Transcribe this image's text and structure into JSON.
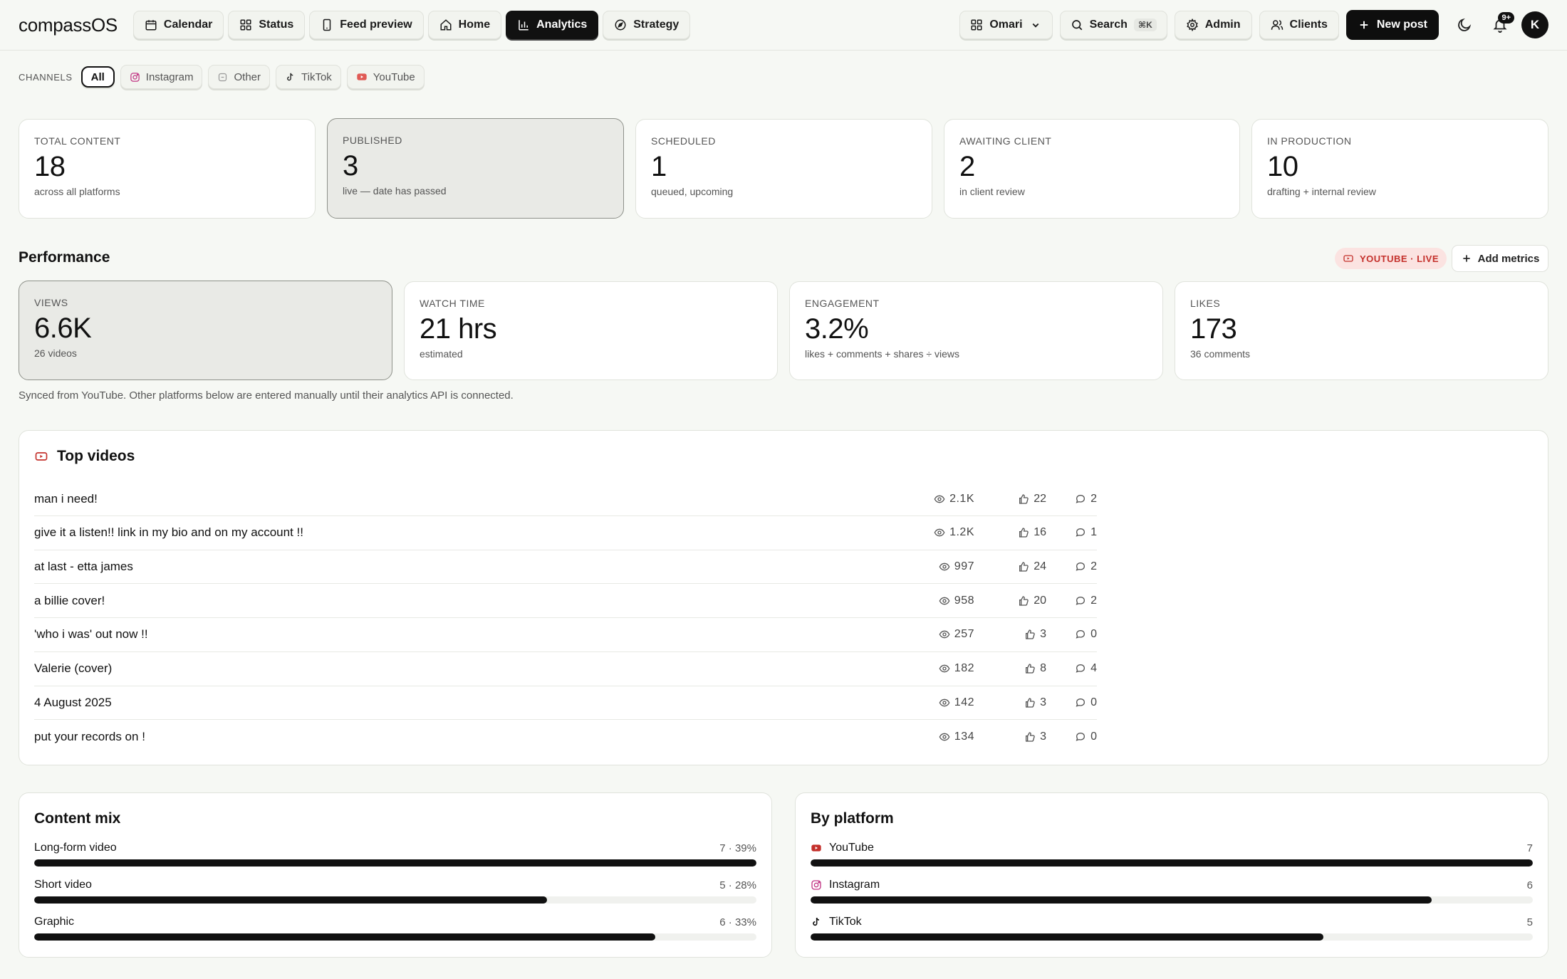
{
  "app": {
    "logo": "compassOS"
  },
  "nav": [
    {
      "label": "Calendar",
      "icon": "calendar-icon"
    },
    {
      "label": "Status",
      "icon": "grid-icon"
    },
    {
      "label": "Feed preview",
      "icon": "phone-icon"
    },
    {
      "label": "Home",
      "icon": "home-icon"
    },
    {
      "label": "Analytics",
      "icon": "bar-chart-icon",
      "active": true
    },
    {
      "label": "Strategy",
      "icon": "compass-icon"
    }
  ],
  "toolbar": {
    "workspace": "Omari",
    "search_label": "Search",
    "search_shortcut": "⌘K",
    "admin": "Admin",
    "clients": "Clients",
    "new_post": "New post",
    "notifications_badge": "9+",
    "avatar_initial": "K"
  },
  "channels": {
    "label": "CHANNELS",
    "items": [
      "All",
      "Instagram",
      "Other",
      "TikTok",
      "YouTube"
    ],
    "selected": "All"
  },
  "stats": [
    {
      "label": "TOTAL CONTENT",
      "value": "18",
      "sub": "across all platforms"
    },
    {
      "label": "PUBLISHED",
      "value": "3",
      "sub": "live — date has passed",
      "selected": true
    },
    {
      "label": "SCHEDULED",
      "value": "1",
      "sub": "queued, upcoming"
    },
    {
      "label": "AWAITING CLIENT",
      "value": "2",
      "sub": "in client review"
    },
    {
      "label": "IN PRODUCTION",
      "value": "10",
      "sub": "drafting + internal review"
    }
  ],
  "performance": {
    "title": "Performance",
    "source_badge": "YOUTUBE · LIVE",
    "add_metrics": "Add metrics",
    "metrics": [
      {
        "label": "VIEWS",
        "value": "6.6K",
        "sub": "26 videos",
        "selected": true
      },
      {
        "label": "WATCH TIME",
        "value": "21 hrs",
        "sub": "estimated"
      },
      {
        "label": "ENGAGEMENT",
        "value": "3.2%",
        "sub": "likes + comments + shares ÷ views"
      },
      {
        "label": "LIKES",
        "value": "173",
        "sub": "36 comments"
      }
    ],
    "note": "Synced from YouTube. Other platforms below are entered manually until their analytics API is connected."
  },
  "top_videos": {
    "title": "Top videos",
    "rows": [
      {
        "title": "man i need!",
        "views": "2.1K",
        "likes": "22",
        "comments": "2"
      },
      {
        "title": "give it a listen!! link in my bio and on my account !!",
        "views": "1.2K",
        "likes": "16",
        "comments": "1"
      },
      {
        "title": "at last - etta james",
        "views": "997",
        "likes": "24",
        "comments": "2"
      },
      {
        "title": "a billie cover!",
        "views": "958",
        "likes": "20",
        "comments": "2"
      },
      {
        "title": "'who i was' out now !!",
        "views": "257",
        "likes": "3",
        "comments": "0"
      },
      {
        "title": "Valerie (cover)",
        "views": "182",
        "likes": "8",
        "comments": "4"
      },
      {
        "title": "4 August 2025",
        "views": "142",
        "likes": "3",
        "comments": "0"
      },
      {
        "title": "put your records on !",
        "views": "134",
        "likes": "3",
        "comments": "0"
      }
    ]
  },
  "content_mix": {
    "title": "Content mix",
    "rows": [
      {
        "label": "Long-form video",
        "value": "7 · 39%",
        "fill": 1.0
      },
      {
        "label": "Short video",
        "value": "5 · 28%",
        "fill": 0.71
      },
      {
        "label": "Graphic",
        "value": "6 · 33%",
        "fill": 0.86
      }
    ]
  },
  "by_platform": {
    "title": "By platform",
    "rows": [
      {
        "label": "YouTube",
        "value": "7",
        "fill": 1.0,
        "icon": "youtube-icon"
      },
      {
        "label": "Instagram",
        "value": "6",
        "fill": 0.86,
        "icon": "instagram-icon"
      },
      {
        "label": "TikTok",
        "value": "5",
        "fill": 0.71,
        "icon": "tiktok-icon"
      }
    ]
  },
  "colors": {
    "accent": "#111111",
    "youtube": "#c4302b",
    "instagram": "#c13584",
    "background": "#f6f8f4"
  }
}
